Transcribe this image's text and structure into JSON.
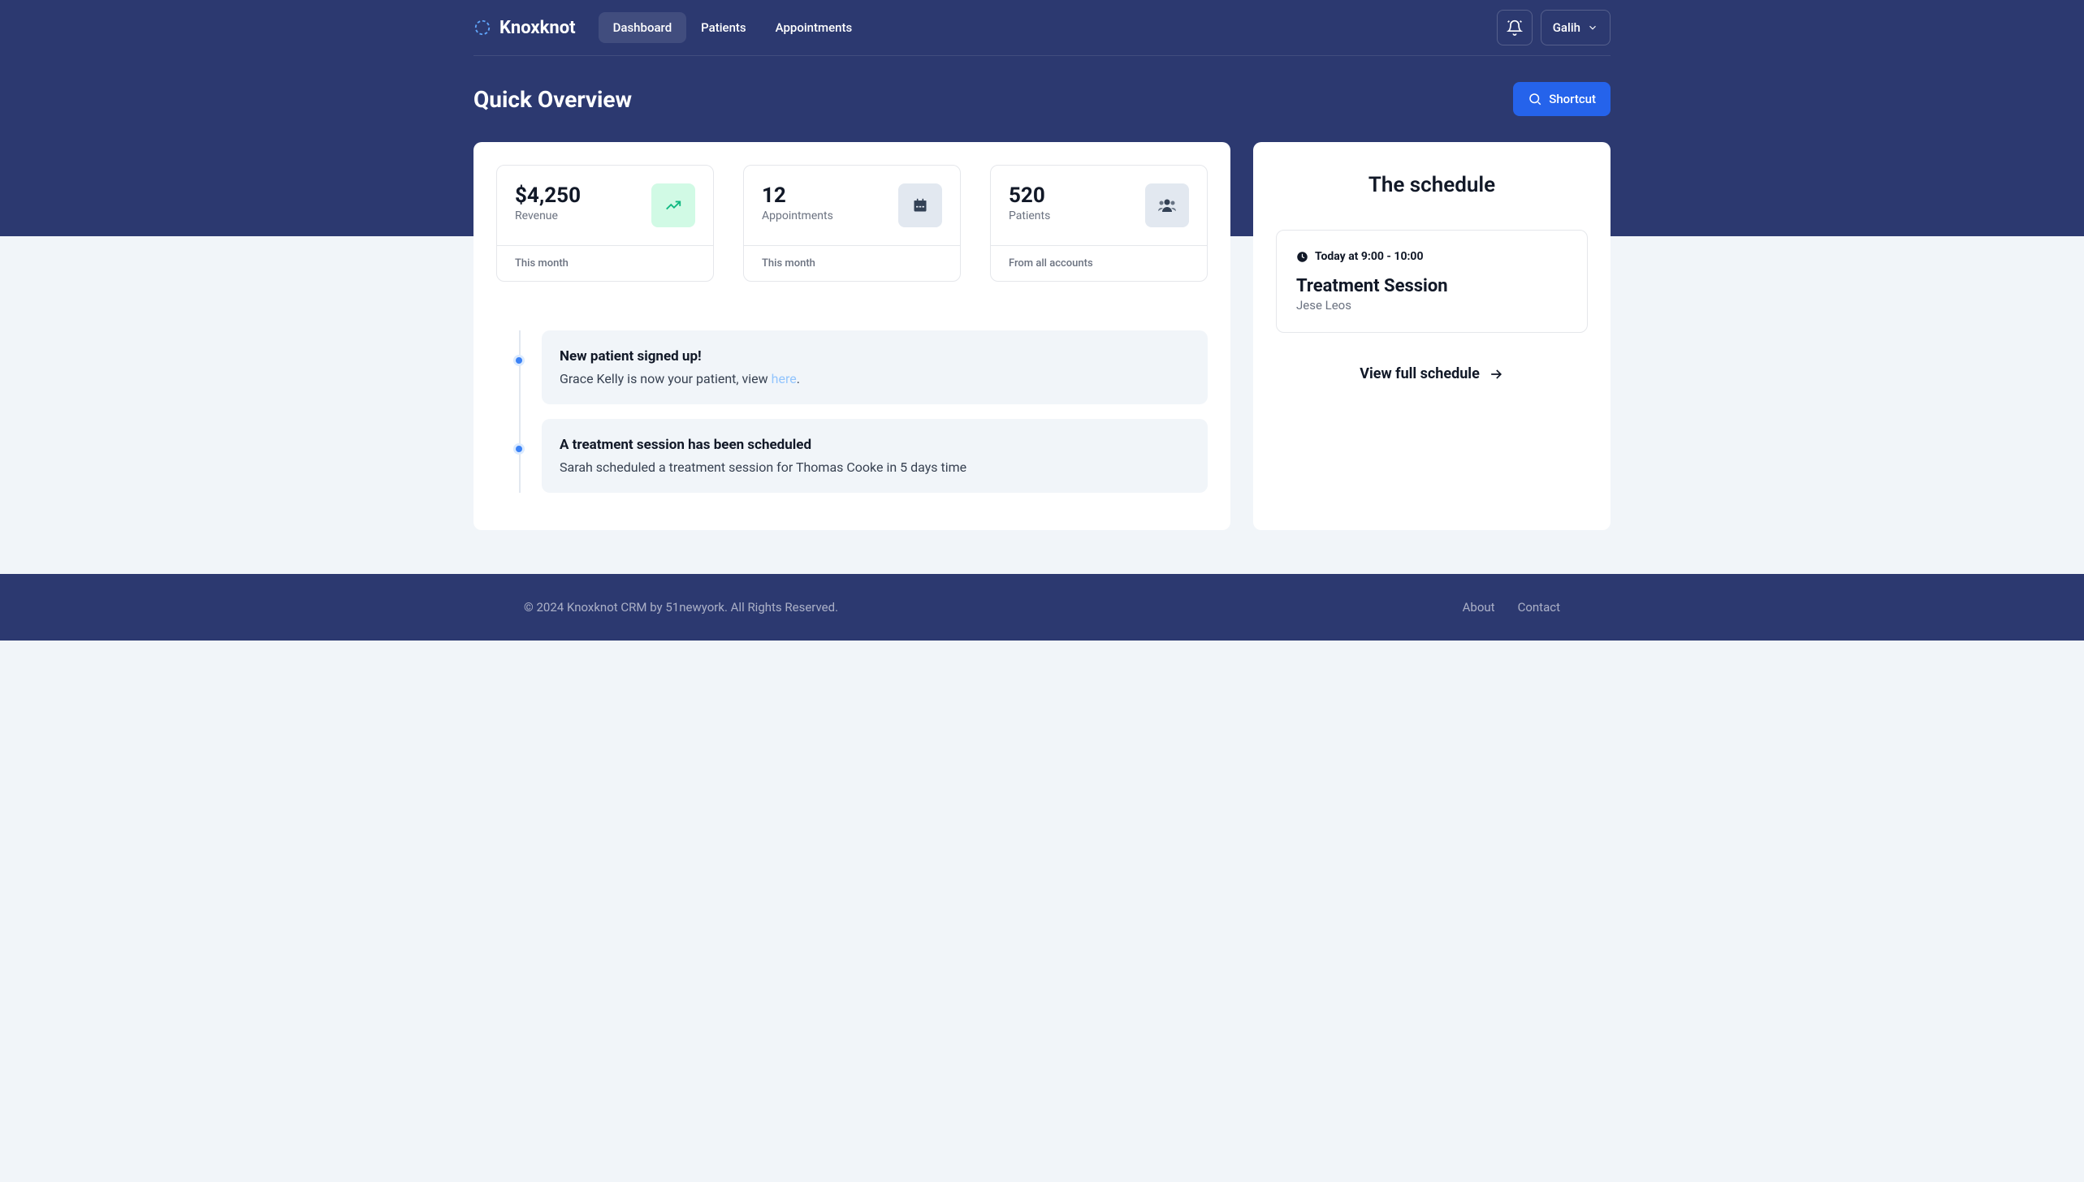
{
  "brand": "Knoxknot",
  "nav": {
    "dashboard": "Dashboard",
    "patients": "Patients",
    "appointments": "Appointments"
  },
  "user": "Galih",
  "page_title": "Quick Overview",
  "shortcut_label": "Shortcut",
  "stats": {
    "revenue": {
      "value": "$4,250",
      "label": "Revenue",
      "foot": "This month"
    },
    "appointments": {
      "value": "12",
      "label": "Appointments",
      "foot": "This month"
    },
    "patients": {
      "value": "520",
      "label": "Patients",
      "foot": "From all accounts"
    }
  },
  "timeline": {
    "item1": {
      "title": "New patient signed up!",
      "text_before": "Grace Kelly is now your patient, view ",
      "link": "here",
      "text_after": "."
    },
    "item2": {
      "title": "A treatment session has been scheduled",
      "text": "Sarah scheduled a treatment session for Thomas Cooke in 5 days time"
    }
  },
  "schedule": {
    "title": "The schedule",
    "time": "Today at 9:00 - 10:00",
    "name": "Treatment Session",
    "patient": "Jese Leos",
    "view_link": "View full schedule"
  },
  "footer": {
    "copyright": "© 2024 Knoxknot CRM by 51newyork. All Rights Reserved.",
    "about": "About",
    "contact": "Contact"
  }
}
